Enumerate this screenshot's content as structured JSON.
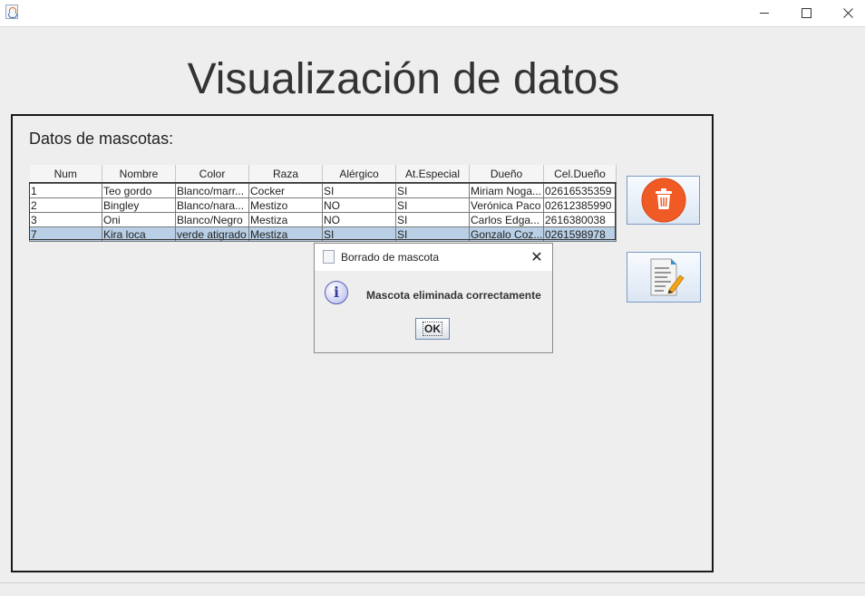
{
  "window": {
    "title": "",
    "controls": {
      "minimize": "minimize-icon",
      "maximize": "maximize-icon",
      "close": "close-icon"
    }
  },
  "page": {
    "title": "Visualización de datos",
    "section_label": "Datos de mascotas:"
  },
  "table": {
    "columns": [
      "Num",
      "Nombre",
      "Color",
      "Raza",
      "Alérgico",
      "At.Especial",
      "Dueño",
      "Cel.Dueño"
    ],
    "rows": [
      [
        "1",
        "Teo gordo",
        "Blanco/marr...",
        "Cocker",
        "SI",
        "SI",
        "Miriam Noga...",
        "02616535359"
      ],
      [
        "2",
        "Bingley",
        "Blanco/nara...",
        "Mestizo",
        "NO",
        "SI",
        "Verónica Paco",
        "02612385990"
      ],
      [
        "3",
        "Oni",
        "Blanco/Negro",
        "Mestiza",
        "NO",
        "SI",
        "Carlos Edga...",
        "2616380038"
      ],
      [
        "7",
        "Kira loca",
        "verde atigrado",
        "Mestiza",
        "SI",
        "SI",
        "Gonzalo Coz...",
        "0261598978"
      ]
    ],
    "selected_row": 3
  },
  "actions": {
    "delete_icon": "trash-icon",
    "edit_icon": "document-edit-icon"
  },
  "dialog": {
    "title": "Borrado de mascota",
    "message": "Mascota eliminada correctamente",
    "ok_label": "OK",
    "close_glyph": "✕",
    "icon": "information-icon",
    "icon_glyph": "i"
  },
  "colors": {
    "selected_row": "#b8cfe5",
    "delete_button_circle": "#f05a24",
    "button_border": "#7a9cc6"
  }
}
